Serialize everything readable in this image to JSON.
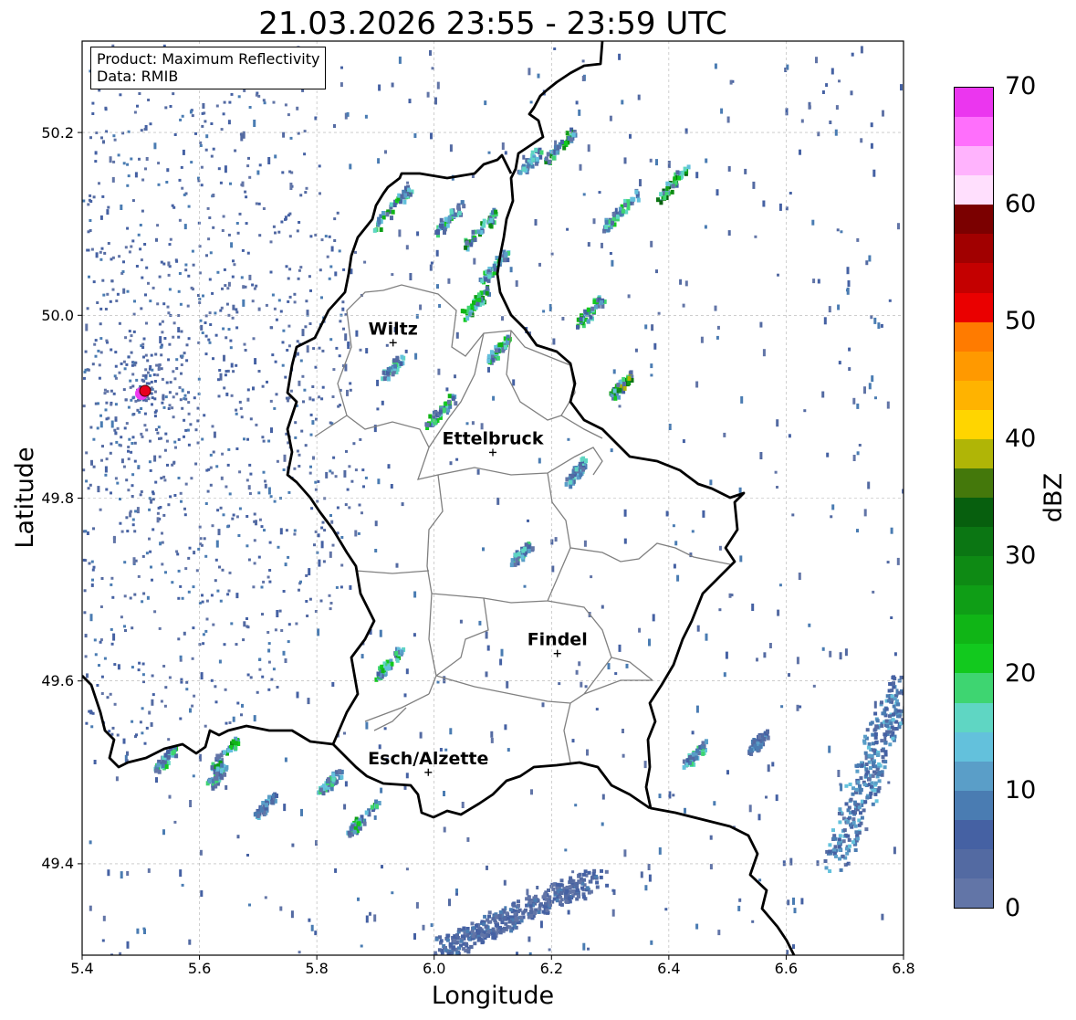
{
  "title": "21.03.2026 23:55 - 23:59 UTC",
  "info": {
    "product": "Product: Maximum Reflectivity",
    "data": "Data: RMIB"
  },
  "map": {
    "lon_range": [
      5.4,
      6.8
    ],
    "lat_range": [
      49.3,
      50.3
    ],
    "xlabel": "Longitude",
    "ylabel": "Latitude",
    "xticks": [
      "5.4",
      "5.6",
      "5.8",
      "6.0",
      "6.2",
      "6.4",
      "6.6",
      "6.8"
    ],
    "yticks": [
      "49.4",
      "49.6",
      "49.8",
      "50.0",
      "50.2"
    ],
    "grid": true
  },
  "cities": [
    {
      "name": "Wiltz",
      "lon": 5.93,
      "lat": 49.97
    },
    {
      "name": "Ettelbruck",
      "lon": 6.1,
      "lat": 49.85
    },
    {
      "name": "Findel",
      "lon": 6.21,
      "lat": 49.63
    },
    {
      "name": "Esch/Alzette",
      "lon": 5.99,
      "lat": 49.5
    }
  ],
  "radar_site": {
    "lon": 5.505,
    "lat": 49.915,
    "color": "#e8001e"
  },
  "colorbar": {
    "label": "dBZ",
    "min": 0,
    "max": 70,
    "ticks": [
      "0",
      "10",
      "20",
      "30",
      "40",
      "50",
      "60",
      "70"
    ],
    "colors": [
      "#6275a7",
      "#536aa2",
      "#4561a3",
      "#4a7cb2",
      "#5a9ec8",
      "#63c1dc",
      "#5fd6c3",
      "#3ed571",
      "#12c91e",
      "#10b516",
      "#0f9e16",
      "#0e8a14",
      "#0b7613",
      "#075f0e",
      "#44780b",
      "#b0b506",
      "#ffd500",
      "#ffb300",
      "#ff9900",
      "#ff7b00",
      "#ea0000",
      "#c40000",
      "#a10000",
      "#7b0000",
      "#ffdffd",
      "#ffb3fd",
      "#ff6ffc",
      "#eb36ef"
    ]
  }
}
